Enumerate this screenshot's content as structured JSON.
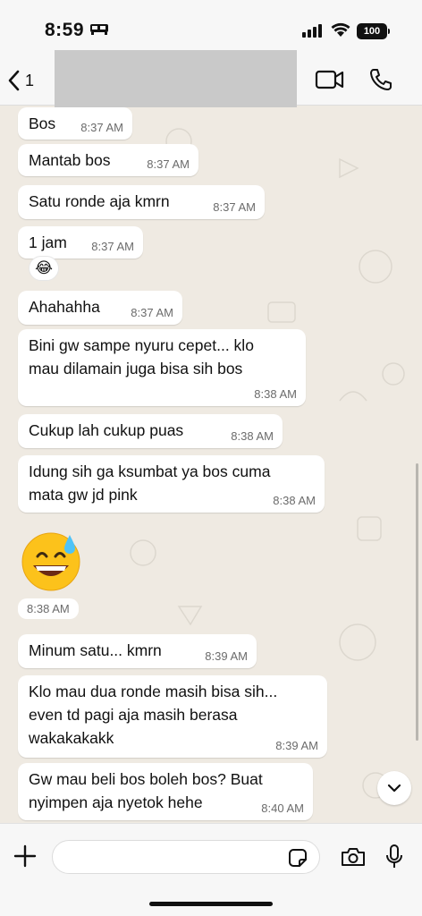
{
  "status_bar": {
    "time": "8:59",
    "battery": "100"
  },
  "header": {
    "back_count": "1"
  },
  "messages": [
    {
      "text": "Bos",
      "time": "8:37 AM"
    },
    {
      "text": "Mantab bos",
      "time": "8:37 AM"
    },
    {
      "text": "Satu ronde aja kmrn",
      "time": "8:37 AM"
    },
    {
      "text": "1 jam",
      "time": "8:37 AM",
      "reaction": "😂"
    },
    {
      "text": "Ahahahha",
      "time": "8:37 AM"
    },
    {
      "text": "Bini gw sampe nyuru cepet... klo\nmau dilamain juga bisa sih bos",
      "time": "8:38 AM"
    },
    {
      "text": "Cukup lah cukup puas",
      "time": "8:38 AM"
    },
    {
      "text": "Idung sih ga ksumbat ya bos cuma\nmata gw jd pink",
      "time": "8:38 AM"
    },
    {
      "text": "😅",
      "time": "8:38 AM"
    },
    {
      "text": "Minum satu... kmrn",
      "time": "8:39 AM"
    },
    {
      "text": "Klo mau dua ronde masih bisa sih...\neven td pagi aja masih berasa\nwakakakakk",
      "time": "8:39 AM"
    },
    {
      "text": "Gw mau beli bos boleh bos? Buat\nnyimpen aja nyetok hehe",
      "time": "8:40 AM"
    }
  ],
  "input": {
    "placeholder": ""
  }
}
